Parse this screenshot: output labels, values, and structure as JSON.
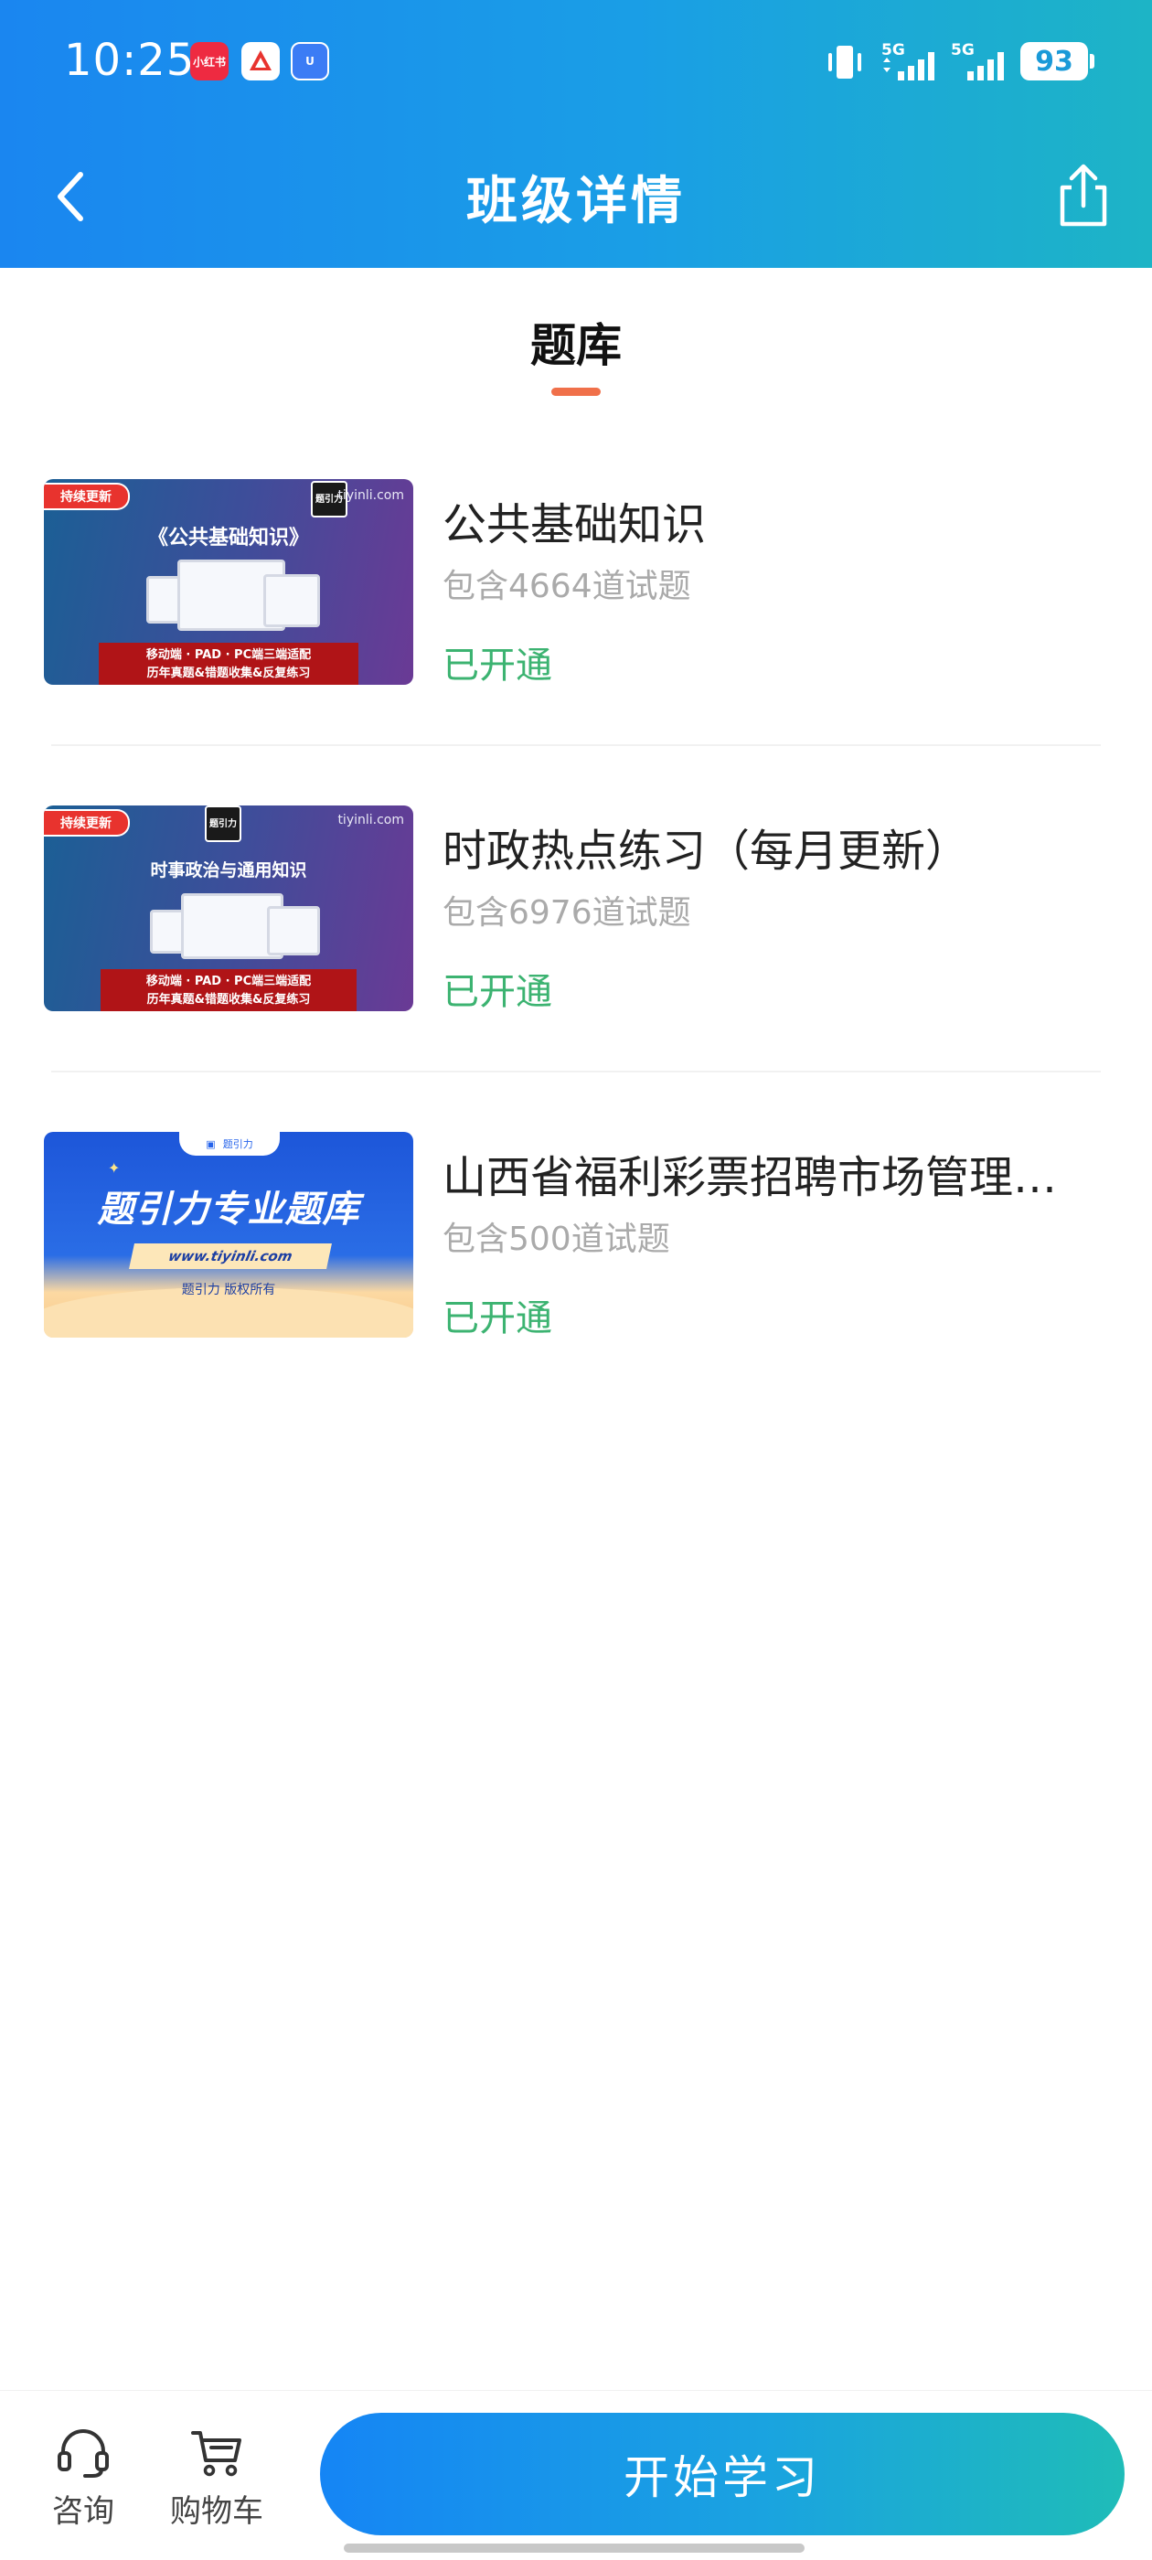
{
  "status_bar": {
    "time": "10:25",
    "app_icons": [
      "小红书",
      "A",
      "U"
    ],
    "network_1": "5G",
    "network_2": "5G",
    "battery": "93"
  },
  "nav": {
    "title": "班级详情",
    "back_icon": "chevron-left-icon",
    "share_icon": "share-icon"
  },
  "section": {
    "title": "题库",
    "accent_color": "#f0704a"
  },
  "items": [
    {
      "name": "公共基础知识",
      "count": "包含4664道试题",
      "status": "已开通",
      "thumb": {
        "badge": "持续更新",
        "url": "tiyinli.com",
        "logo": "题引力",
        "heading": "《公共基础知识》",
        "banner_line1": "移动端 · PAD · PC端三端适配",
        "banner_line2": "历年真题&错题收集&反复练习"
      }
    },
    {
      "name": "时政热点练习（每月更新）",
      "count": "包含6976道试题",
      "status": "已开通",
      "thumb": {
        "badge": "持续更新",
        "url": "tiyinli.com",
        "logo": "题引力",
        "heading": "时事政治与通用知识",
        "banner_line1": "移动端 · PAD · PC端三端适配",
        "banner_line2": "历年真题&错题收集&反复练习"
      }
    },
    {
      "name": "山西省福利彩票招聘市场管理…",
      "count": "包含500道试题",
      "status": "已开通",
      "thumb": {
        "tab": "题引力",
        "title": "题引力专业题库",
        "url": "www.tiyinli.com",
        "copyright": "题引力 版权所有"
      }
    }
  ],
  "bottom_bar": {
    "consult_label": "咨询",
    "consult_icon": "headset-icon",
    "cart_label": "购物车",
    "cart_icon": "cart-icon",
    "start_label": "开始学习"
  },
  "colors": {
    "header_start": "#1a86f0",
    "header_end": "#1db4c6",
    "status_green": "#3cb371"
  }
}
